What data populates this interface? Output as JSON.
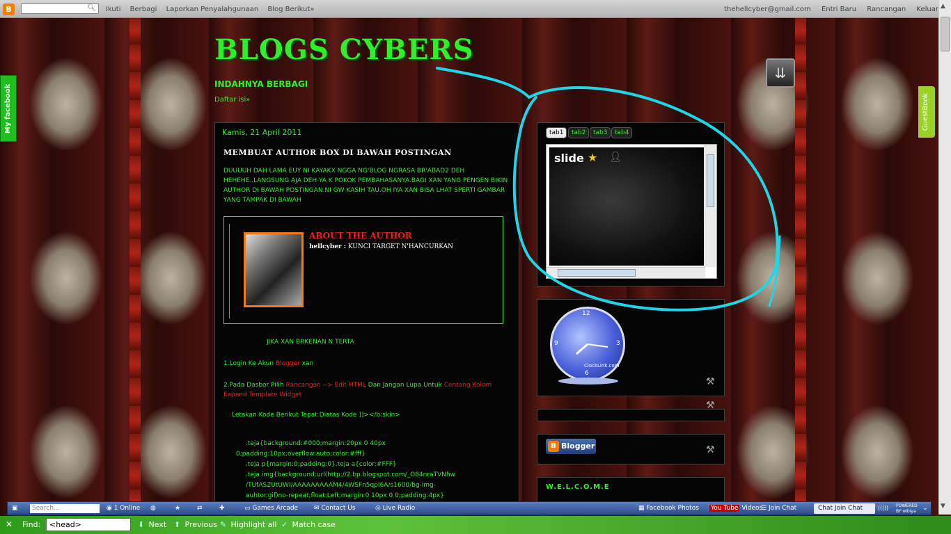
{
  "navbar": {
    "logo": "B",
    "links": [
      "Ikuti",
      "Berbagi",
      "Laporkan Penyalahgunaan",
      "Blog Berikut»"
    ],
    "user_email": "thehellcyber@gmail.com",
    "right_links": [
      "Entri Baru",
      "Rancangan",
      "Keluar"
    ]
  },
  "header": {
    "title": "BLOGS CYBERS",
    "description": "INDAHNYA BERBAGI",
    "nav_link": "Daftar isi»"
  },
  "side_tabs": {
    "facebook": "My facebook",
    "guestbook": "GuestBook"
  },
  "post": {
    "date": "Kamis, 21 April 2011",
    "title": "MEMBUAT AUTHOR BOX DI BAWAH POSTINGAN",
    "intro": "DUUUUH DAH LAMA EUY NI KAYAKX NGGA NG'BLOG NGRASA BR'ABAD2 DEH HEHEHE..LANGSUNG AJA DEH YA K POKOK PEMBAHASANYA.BAGI XAN YANG PENGEN BIKIN AUTHOR DI BAWAH POSTINGAN.NI GW KASIH TAU.OH IYA XAN BISA LHAT SPERTI GAMBAR YANG TAMPAK DI BAWAH",
    "author_box": {
      "heading": "ABOUT THE AUTHOR",
      "name": "hellcyber :",
      "tagline": " KUNCI TARGET N'HANCURKAN"
    },
    "jika": "JIKA XAN BRKENAN N TERTA",
    "step1_pre": "1.Login Ke Akun ",
    "step1_link": "Blogger",
    "step1_post": " xan",
    "step2_pre": "2.Pada Dasbor Pilih ",
    "step2_link1": "Rancangan --> Edit HTML",
    "step2_mid": " Dan Jangan Lupa Untuk ",
    "step2_link2": "Centang Kolom Expand Template Widget",
    "letakan": "Letakan Kode Berikut Tepat Diatas Kode ]]></b:skin>",
    "code_lines": [
      ".teja{background:#000;margin:20px 0 40px",
      "0;padding:10px;overflow:auto;color:#fff}",
      ".teja p{margin:0;padding:0}.teja a{color:#FFF}",
      ".teja img{background:url(http://2.bp.blogspot.com/_O84nraTVNhw",
      "/TUfASZUtUWI/AAAAAAAAAM4/4WSFn5qpI6A/s1600/bg-img-",
      "auhtor.gif)no-repeat;float:Left;margin:0 10px 0 0;padding:4px}"
    ]
  },
  "sidebar": {
    "tabs": [
      "tab1",
      "tab2",
      "tab3",
      "tab4"
    ],
    "active_tab": "tab1",
    "slide_logo": "slide",
    "clock_label": "ClockLink.com",
    "clock_numbers": [
      "12",
      "3",
      "6",
      "9"
    ],
    "blogger_button": "Blogger",
    "welcome": "W.E.L.C.O.M.E"
  },
  "wibiya": {
    "search_placeholder": "Search...",
    "online": "1 Online",
    "games": "Games Arcade",
    "contact": "Contact Us",
    "radio": "Live Radio",
    "fb_photos": "Facebook Photos",
    "yt_badge": "You Tube",
    "videos": "Videos",
    "join_chat": "Join Chat",
    "chat_button": "Chat Join Chat",
    "powered": "POWERED BY wibiya"
  },
  "findbar": {
    "label": "Find:",
    "value": "<head>",
    "next": "Next",
    "previous": "Previous",
    "highlight": "Highlight all",
    "match_case": "Match case"
  },
  "colors": {
    "accent_green": "#2ef02a",
    "link_red": "#e82020",
    "scribble_cyan": "#1fd6e8"
  }
}
